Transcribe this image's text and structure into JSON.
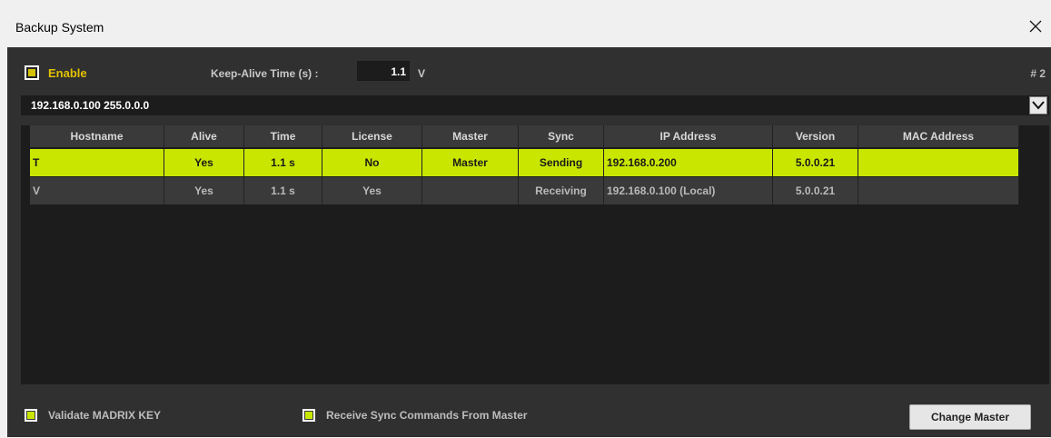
{
  "window": {
    "title": "Backup System"
  },
  "options": {
    "enable_label": "Enable",
    "keepalive_label": "Keep-Alive Time (s) :",
    "keepalive_value": "1.1",
    "keepalive_unit": "V",
    "page_number": "# 2"
  },
  "network": {
    "selected": "192.168.0.100 255.0.0.0"
  },
  "table": {
    "headers": [
      "Hostname",
      "Alive",
      "Time",
      "License",
      "Master",
      "Sync",
      "IP Address",
      "Version",
      "MAC Address"
    ],
    "rows": [
      {
        "hostname": "T",
        "alive": "Yes",
        "time": "1.1 s",
        "license": "No",
        "master": "Master",
        "sync": "Sending",
        "ip": "192.168.0.200",
        "version": "5.0.0.21",
        "mac": "",
        "selected": true
      },
      {
        "hostname": "V",
        "alive": "Yes",
        "time": "1.1 s",
        "license": "Yes",
        "master": "",
        "sync": "Receiving",
        "ip": "192.168.0.100 (Local)",
        "version": "5.0.0.21",
        "mac": "",
        "selected": false
      }
    ]
  },
  "footer": {
    "validate_label": "Validate MADRIX KEY",
    "receive_sync_label": "Receive Sync Commands From Master",
    "change_master_label": "Change Master"
  },
  "colors": {
    "accent": "#c8e600",
    "enable_text": "#e3c100",
    "background": "#303030"
  }
}
